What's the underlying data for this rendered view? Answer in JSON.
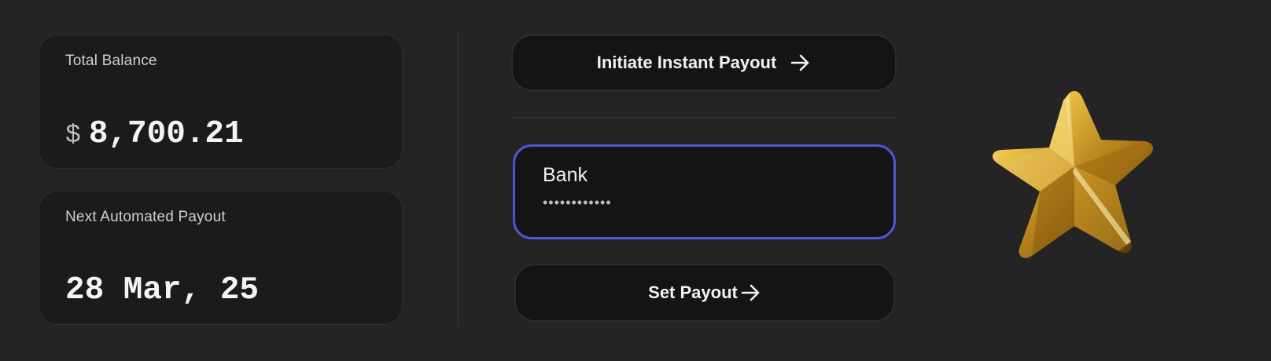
{
  "balance": {
    "label": "Total Balance",
    "currency_symbol": "$",
    "amount": "8,700.21"
  },
  "next_payout": {
    "label": "Next Automated Payout",
    "date": "28 Mar, 25"
  },
  "instant_payout": {
    "label": "Initiate Instant Payout",
    "icon": "arrow-right-icon"
  },
  "bank_field": {
    "label": "Bank",
    "value": "••••••••••••"
  },
  "set_payout": {
    "label": "Set Payout",
    "icon": "arrow-right-icon"
  },
  "decor": {
    "icon": "gold-star-icon"
  },
  "colors": {
    "background": "#242424",
    "card": "#1b1b1b",
    "button": "#141414",
    "accent": "#4f55d6",
    "star_gold": "#d4a52a"
  }
}
